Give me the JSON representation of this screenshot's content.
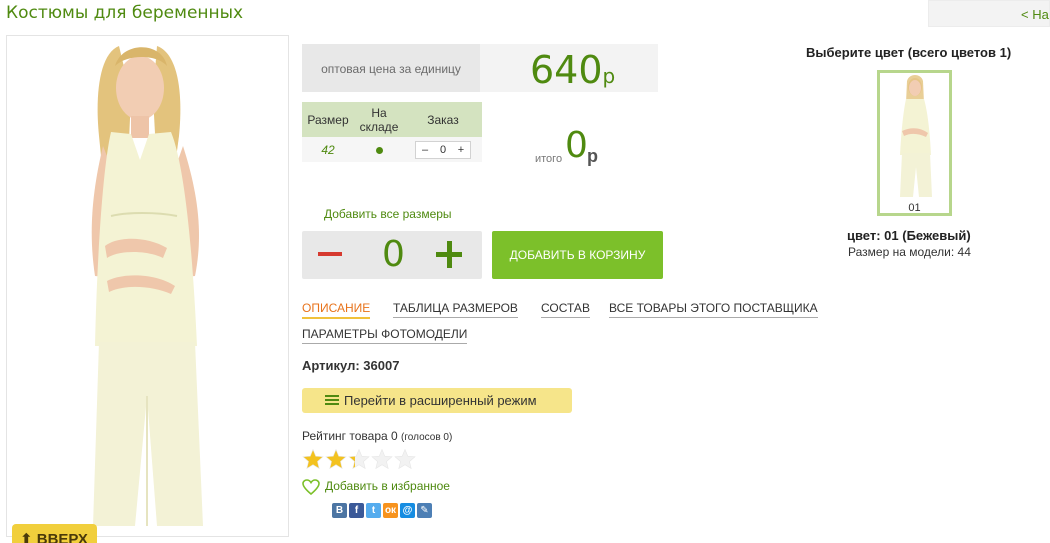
{
  "header": {
    "page_title": "Костюмы для беременных",
    "back_link": "< На"
  },
  "price": {
    "label": "оптовая цена за единицу",
    "value": "640",
    "currency": "р"
  },
  "size_table": {
    "headers": [
      "Размер",
      "На складе",
      "Заказ"
    ],
    "rows": [
      {
        "size": "42",
        "order_minus": "–",
        "order_qty": "0",
        "order_plus": "+"
      }
    ]
  },
  "total": {
    "label": "итого",
    "value": "0",
    "currency": "р"
  },
  "quantity": {
    "add_all_sizes": "Добавить все размеры",
    "value": "0"
  },
  "cart": {
    "add_button": "ДОБАВИТЬ В КОРЗИНУ"
  },
  "tabs": [
    {
      "label": "ОПИСАНИЕ",
      "active": true
    },
    {
      "label": "ТАБЛИЦА РАЗМЕРОВ",
      "active": false
    },
    {
      "label": "СОСТАВ",
      "active": false
    },
    {
      "label": "ВСЕ ТОВАРЫ ЭТОГО ПОСТАВЩИКА",
      "active": false
    },
    {
      "label": "ПАРАМЕТРЫ ФОТОМОДЕЛИ",
      "active": false
    }
  ],
  "product": {
    "article": "Артикул: 36007",
    "extended_mode": "Перейти в расширенный режим",
    "rating_text": "Рейтинг товара 0",
    "rating_votes": "(голосов 0)",
    "rating_value": 2.3,
    "rating_max": 5,
    "favorite": "Добавить в избранное"
  },
  "share_icons": [
    {
      "name": "vkontakte-icon",
      "glyph": "B",
      "color": "#4c75a3"
    },
    {
      "name": "facebook-icon",
      "glyph": "f",
      "color": "#3b5998"
    },
    {
      "name": "twitter-icon",
      "glyph": "t",
      "color": "#55acee"
    },
    {
      "name": "odnoklassniki-icon",
      "glyph": "ок",
      "color": "#f7931e"
    },
    {
      "name": "mailru-icon",
      "glyph": "@",
      "color": "#168de2"
    },
    {
      "name": "livejournal-icon",
      "glyph": "✎",
      "color": "#4d7fb5"
    }
  ],
  "color_chooser": {
    "heading": "Выберите цвет (всего цветов 1)",
    "thumb_label": "01",
    "color_name": "цвет: 01 (Бежевый)",
    "model_size": "Размер на модели: 44"
  },
  "scroll_up": {
    "label": "ВВЕРХ"
  },
  "colors": {
    "accent_green": "#4f8a10",
    "cart_button": "#7cc02a",
    "active_tab": "#e8731b",
    "extended_button": "#f6e58a",
    "up_button": "#f1cf3c",
    "minus_red": "#d63a2f"
  }
}
